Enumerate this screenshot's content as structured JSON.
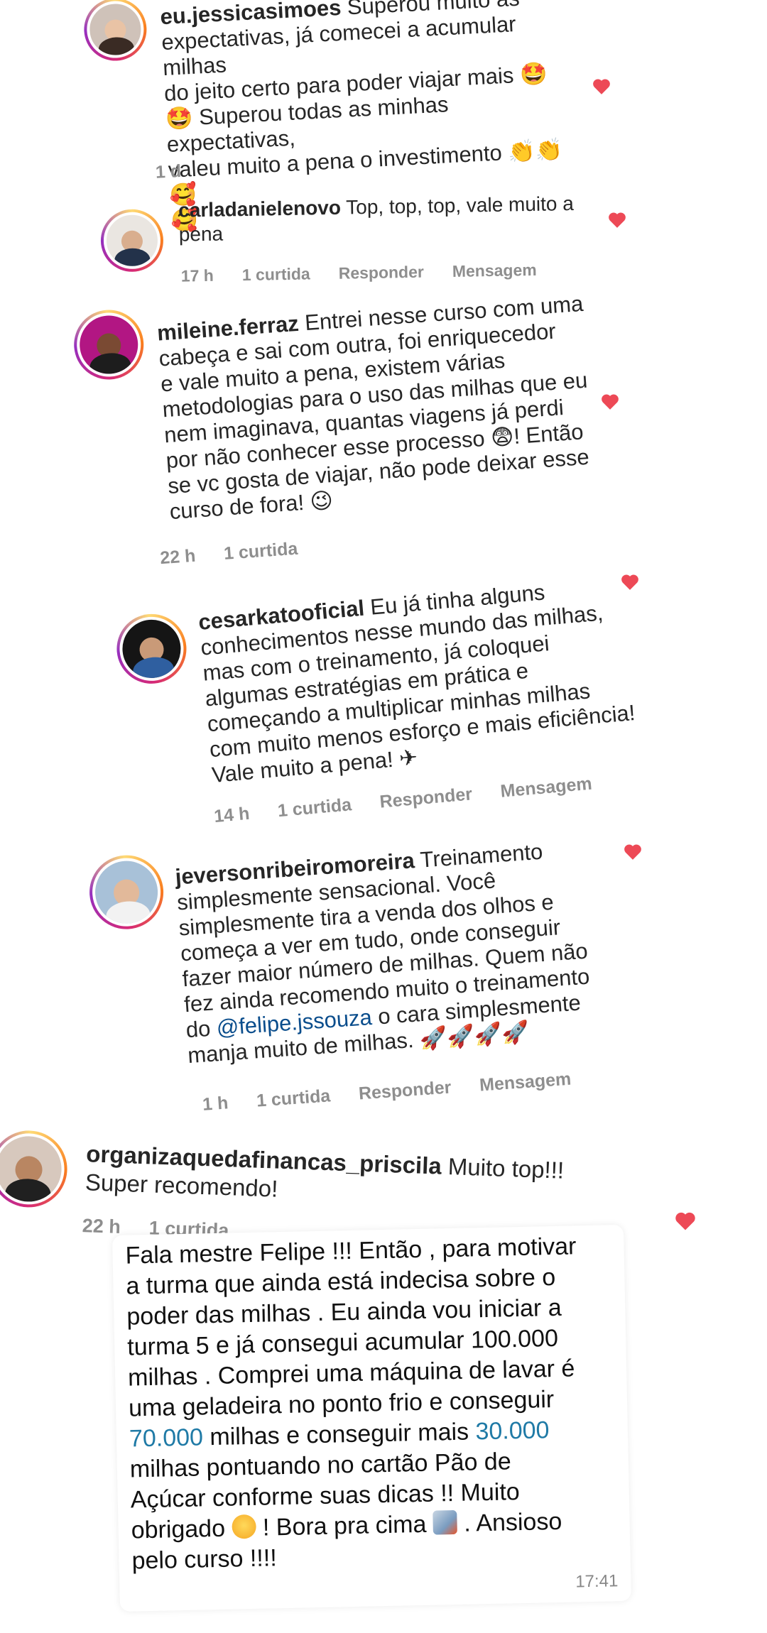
{
  "comments": [
    {
      "username": "eu.jessicasimoes",
      "lines": [
        "Superou muito as",
        "expectativas, já comecei a acumular milhas",
        "do jeito certo para poder viajar mais 🤩",
        "🤩 Superou todas as minhas expectativas,",
        "valeu muito a pena o investimento 👏👏🥰",
        "🥰"
      ],
      "time": "1 d",
      "likes": "",
      "reply": "",
      "message": ""
    },
    {
      "username": "carladanielenovo",
      "lines": [
        "Top, top, top, vale muito a",
        "pena"
      ],
      "time": "17 h",
      "likes": "1 curtida",
      "reply": "Responder",
      "message": "Mensagem"
    },
    {
      "username": "mileine.ferraz",
      "lines": [
        "Entrei nesse curso com uma",
        "cabeça e sai com outra, foi enriquecedor",
        "e vale muito a pena, existem várias",
        "metodologias para o uso das milhas que eu",
        "nem imaginava, quantas viagens já perdi",
        "por não conhecer esse processo 😨! Então",
        "se vc gosta de viajar, não pode deixar esse",
        "curso de fora! 😉"
      ],
      "time": "22 h",
      "likes": "1 curtida",
      "reply": "",
      "message": ""
    },
    {
      "username": "cesarkatooficial",
      "lines": [
        "Eu já tinha alguns",
        "conhecimentos nesse mundo das milhas,",
        "mas com o treinamento, já coloquei",
        "algumas estratégias em prática e",
        "começando a multiplicar minhas milhas",
        "com muito menos esforço e mais eficiência!",
        "Vale muito a pena! ✈"
      ],
      "time": "14 h",
      "likes": "1 curtida",
      "reply": "Responder",
      "message": "Mensagem"
    },
    {
      "username": "jeversonribeiromoreira",
      "lines": [
        "Treinamento",
        "simplesmente sensacional. Você",
        "simplesmente tira a venda dos olhos e",
        "começa a ver em tudo, onde conseguir",
        "fazer maior número de milhas. Quem não",
        "fez ainda recomendo muito o treinamento",
        "do",
        "o cara simplesmente",
        "manja muito de milhas. 🚀🚀🚀🚀"
      ],
      "mention": "@felipe.jssouza",
      "time": "1 h",
      "likes": "1 curtida",
      "reply": "Responder",
      "message": "Mensagem"
    },
    {
      "username": "organizaquedafinancas_priscila",
      "lines": [
        "Muito top!!!",
        "Super recomendo!"
      ],
      "time": "22 h",
      "likes": "1 curtida",
      "reply": "",
      "message": ""
    }
  ],
  "chat": {
    "lines": [
      "Fala mestre Felipe !!! Então , para motivar",
      "a turma que ainda está indecisa sobre o",
      "poder das milhas . Eu ainda vou iniciar a",
      "turma 5 e já consegui acumular 100.000",
      "milhas . Comprei uma máquina de lavar é",
      "uma geladeira no ponto frio e conseguir",
      "70.000",
      "milhas e conseguir mais",
      "30.000",
      "milhas pontuando no cartão Pão de",
      "Açúcar conforme suas dicas !! Muito",
      "obrigado",
      "! Bora pra cima",
      ". Ansioso",
      "pelo curso !!!!"
    ],
    "time": "17:41"
  },
  "colors": {
    "heart": "#ed4956",
    "meta": "#8e8e8e",
    "link": "#0a4d8c",
    "number_link": "#1f7aa6"
  }
}
